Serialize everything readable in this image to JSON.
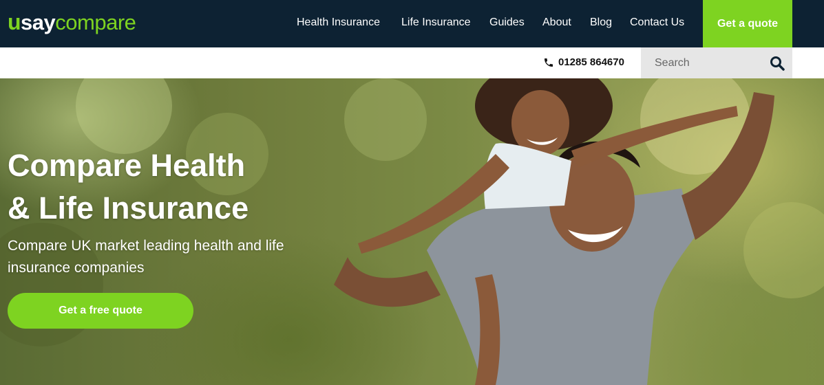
{
  "brand": {
    "logo_u": "u",
    "logo_say": "say",
    "logo_compare": "compare",
    "accent": "#7ed321",
    "navy": "#0d2233"
  },
  "nav": {
    "items": [
      {
        "label": "Health Insurance"
      },
      {
        "label": "Life Insurance"
      },
      {
        "label": "Guides"
      },
      {
        "label": "About"
      },
      {
        "label": "Blog"
      },
      {
        "label": "Contact Us"
      }
    ],
    "cta_label": "Get a quote"
  },
  "subbar": {
    "phone_icon": "phone-icon",
    "phone": "01285 864670",
    "search_placeholder": "Search",
    "search_icon": "search-icon"
  },
  "hero": {
    "title_line1": "Compare Health",
    "title_line2": "& Life Insurance",
    "subtitle": "Compare UK market leading health and life insurance companies",
    "cta_label": "Get a free quote"
  }
}
